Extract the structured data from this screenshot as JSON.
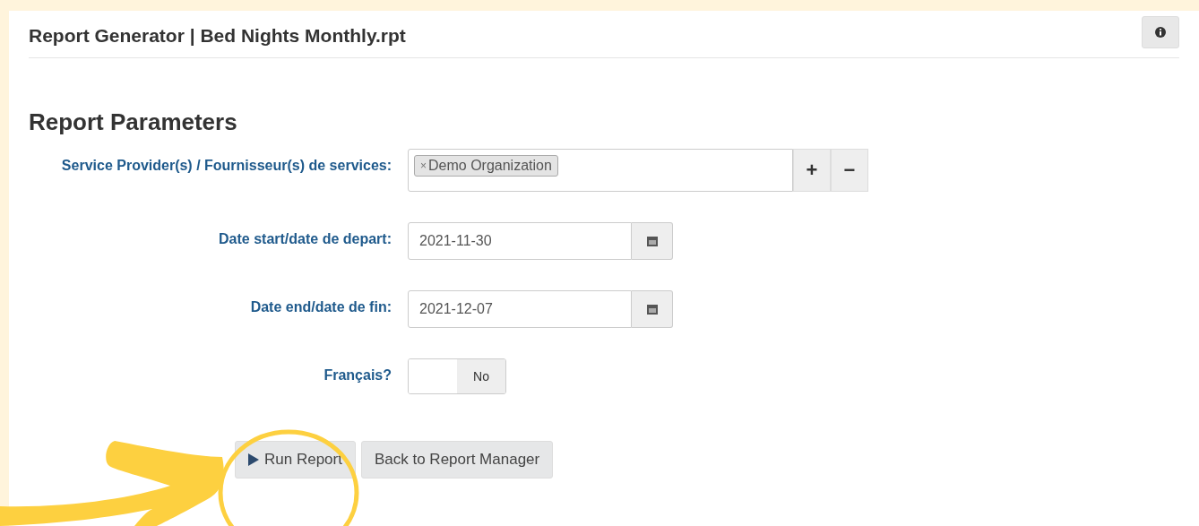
{
  "header": {
    "title": "Report Generator | Bed Nights Monthly.rpt"
  },
  "section_title": "Report Parameters",
  "fields": [
    {
      "kind": "multiselect",
      "label": "Service Provider(s) / Fournisseur(s) de services:",
      "tags": [
        {
          "remove": "×",
          "text": "Demo Organization"
        }
      ],
      "add": "+",
      "remove": "−"
    },
    {
      "kind": "date",
      "label": "Date start/date de depart:",
      "value": "2021-11-30"
    },
    {
      "kind": "date",
      "label": "Date end/date de fin:",
      "value": "2021-12-07"
    },
    {
      "kind": "toggle",
      "label": "Français?",
      "on": false,
      "off_label": "No"
    }
  ],
  "buttons": [
    {
      "kind": "run",
      "label": "Run Report"
    },
    {
      "kind": "back",
      "label": "Back to Report Manager"
    }
  ]
}
